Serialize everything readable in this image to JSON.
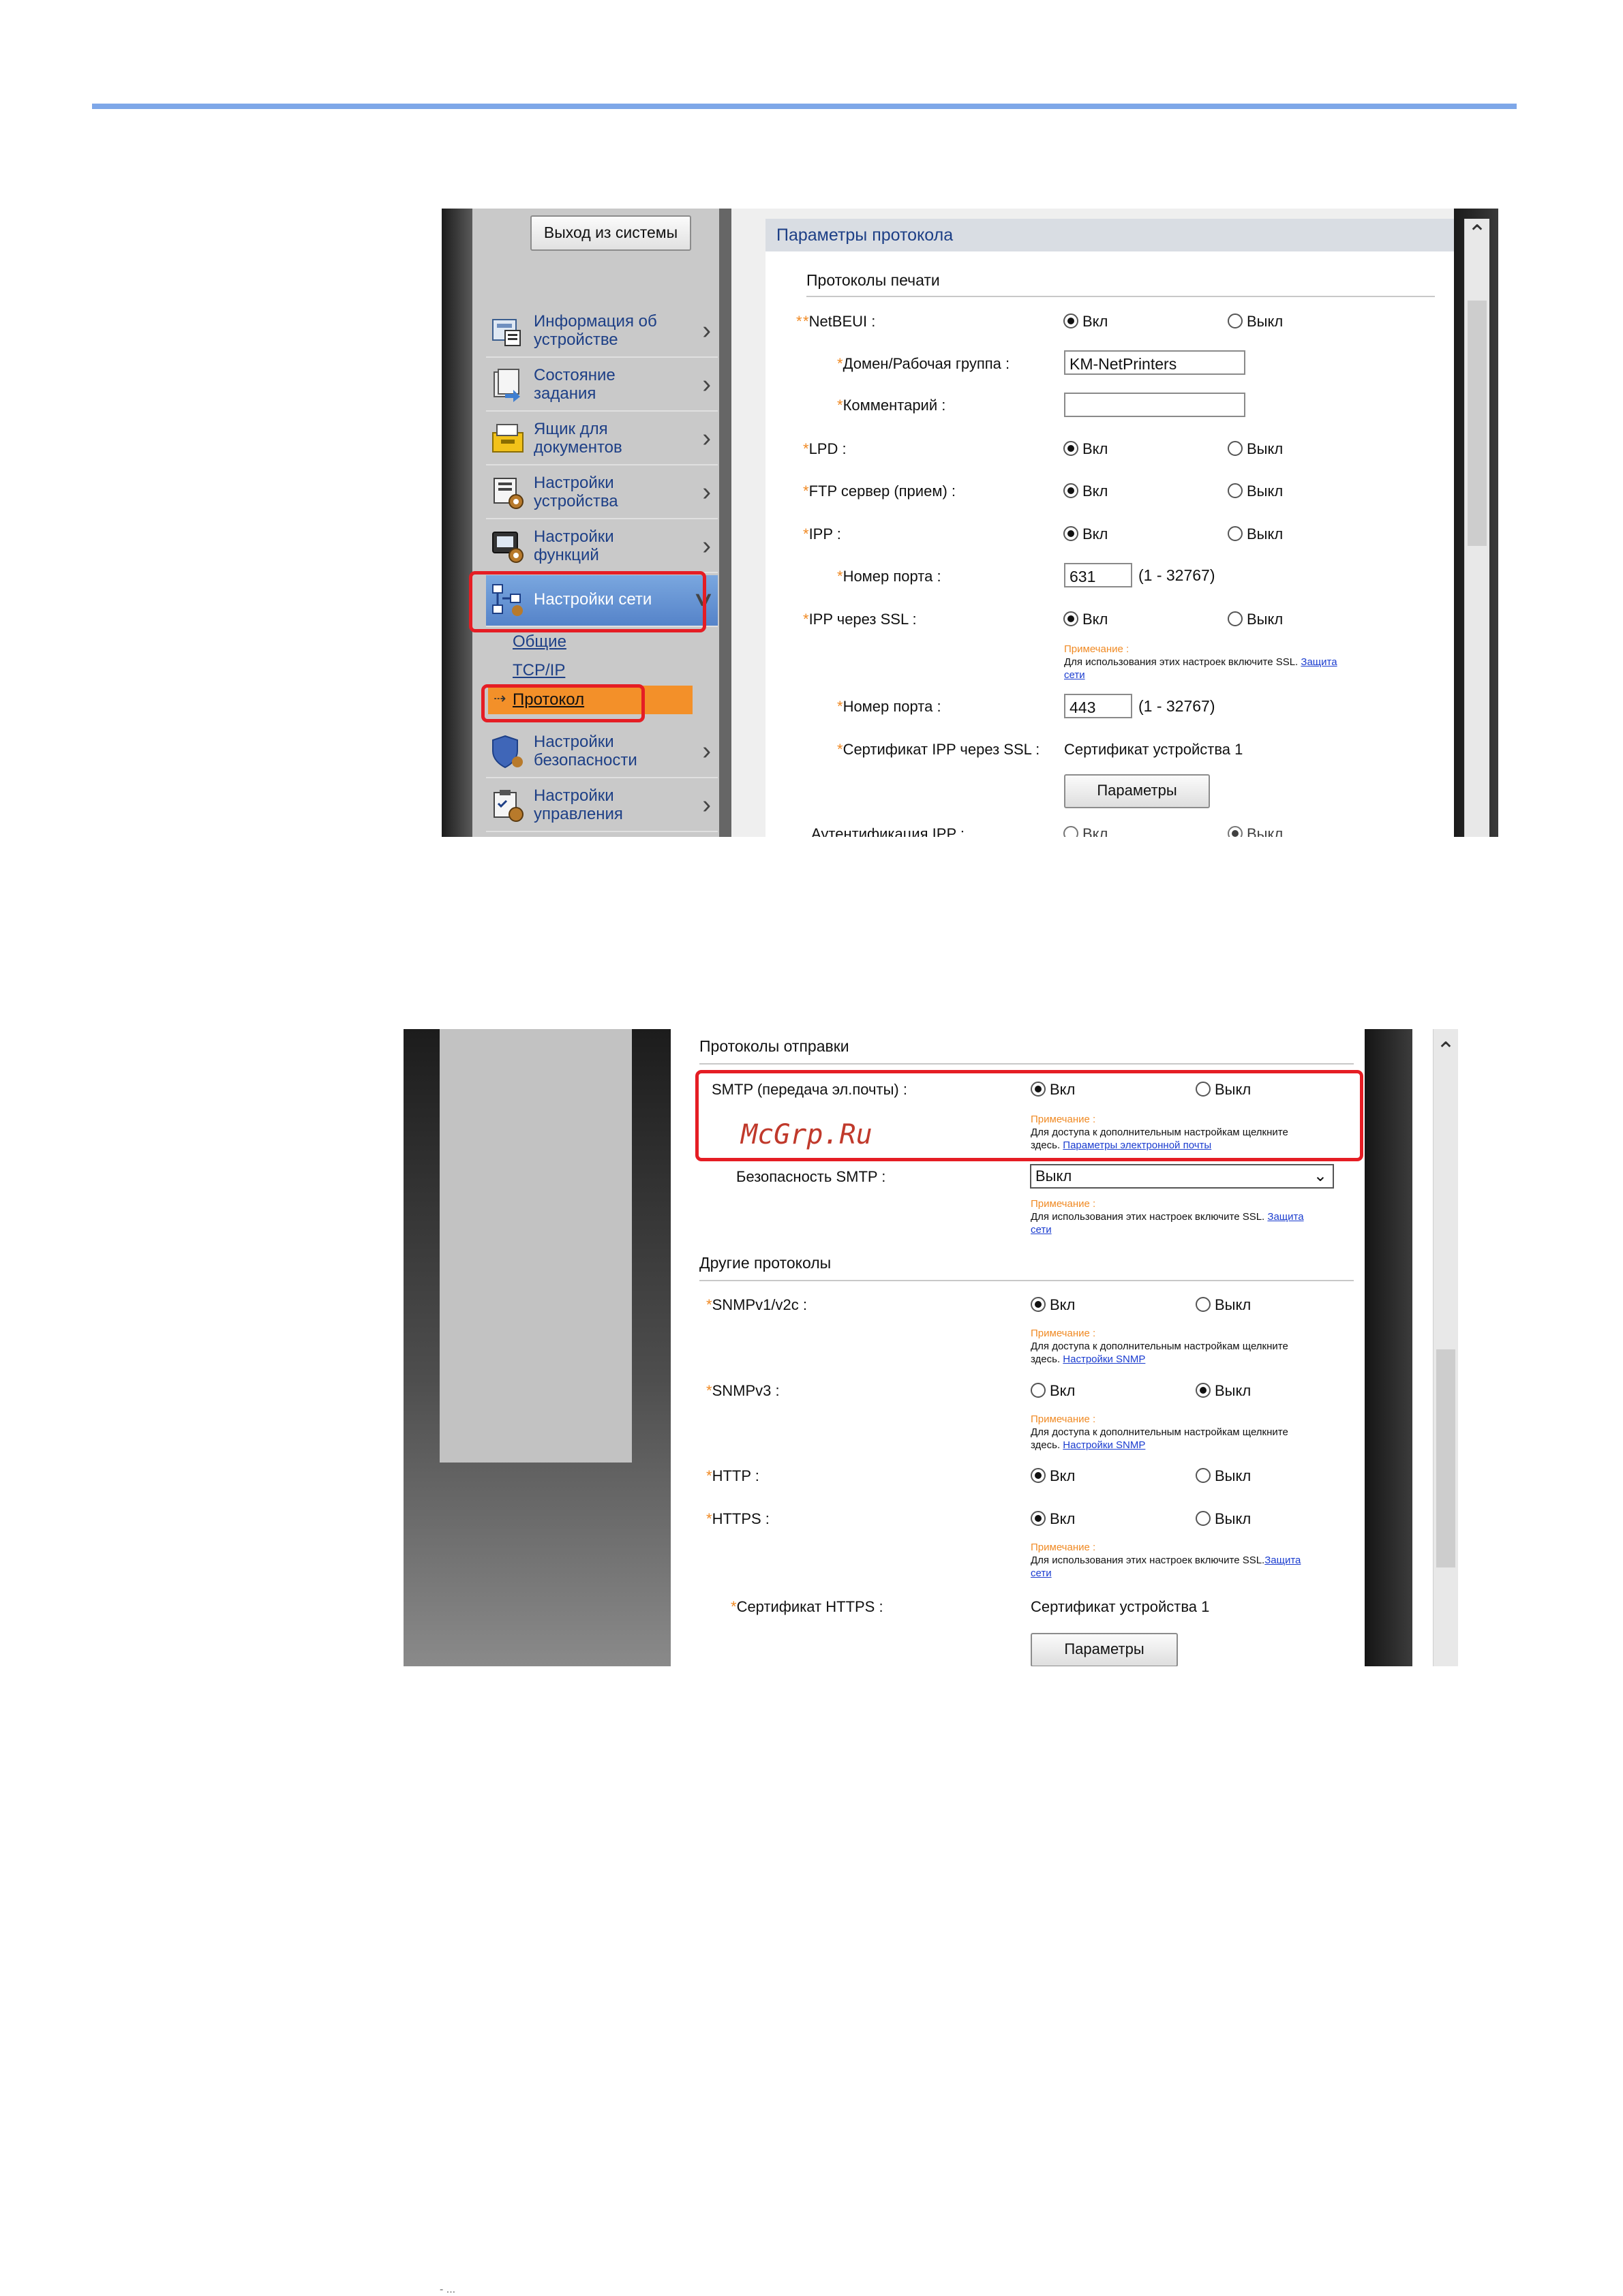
{
  "shot1": {
    "logout_label": "Выход из системы",
    "nav": [
      {
        "label": "Информация об\nустройстве",
        "icon": "device-info-icon"
      },
      {
        "label": "Состояние\nзадания",
        "icon": "job-status-icon"
      },
      {
        "label": "Ящик для\nдокументов",
        "icon": "document-box-icon"
      },
      {
        "label": "Настройки\nустройства",
        "icon": "device-settings-icon"
      },
      {
        "label": "Настройки\nфункций",
        "icon": "function-settings-icon"
      },
      {
        "label": "Настройки сети",
        "icon": "network-settings-icon"
      },
      {
        "label": "Настройки\nбезопасности",
        "icon": "security-settings-icon"
      },
      {
        "label": "Настройки\nуправления",
        "icon": "management-settings-icon"
      }
    ],
    "sub": [
      "Общие",
      "TCP/IP",
      "Протокол"
    ],
    "panel_title": "Параметры протокола",
    "section": "Протоколы печати",
    "on": "Вкл",
    "off": "Выкл",
    "rows": {
      "netbeui": "NetBEUI :",
      "domain": "Домен/Рабочая группа :",
      "domain_value": "KM-NetPrinters",
      "comment": "Комментарий :",
      "comment_value": "",
      "lpd": "LPD :",
      "ftp": "FTP сервер (прием) :",
      "ipp": "IPP :",
      "ipp_port": "Номер порта :",
      "ipp_port_value": "631",
      "range": "(1 - 32767)",
      "ipp_ssl": "IPP через SSL :",
      "note_head": "Примечание :",
      "note_ssl": "Для использования этих настроек включите SSL.",
      "note_link1": "Защита",
      "note_link2": "сети",
      "ssl_port": "Номер порта :",
      "ssl_port_value": "443",
      "cert_label": "Сертификат IPP через SSL :",
      "cert_value": "Сертификат устройства 1",
      "params_btn": "Параметры",
      "auth": "Аутентификация IPP :"
    }
  },
  "shot2": {
    "section_send": "Протоколы отправки",
    "smtp": "SMTP (передача эл.почты) :",
    "on": "Вкл",
    "off": "Выкл",
    "note_head": "Примечание :",
    "note_access": "Для доступа к дополнительным настройкам щелкните",
    "note_here": "здесь.",
    "email_link": "Параметры электронной почты",
    "smtp_security": "Безопасность SMTP :",
    "smtp_security_value": "Выкл",
    "note_ssl": "Для использования этих настроек включите SSL.",
    "link_protect": "Защита",
    "link_net": "сети",
    "section_other": "Другие протоколы",
    "snmpv1": "SNMPv1/v2c :",
    "snmp_link": "Настройки SNMP",
    "snmpv3": "SNMPv3 :",
    "http": "HTTP :",
    "https": "HTTPS :",
    "https_cert": "Сертификат HTTPS :",
    "cert_value": "Сертификат устройства 1",
    "params_btn": "Параметры",
    "watermark": "McGrp.Ru"
  },
  "footer_glyph": "- ..."
}
